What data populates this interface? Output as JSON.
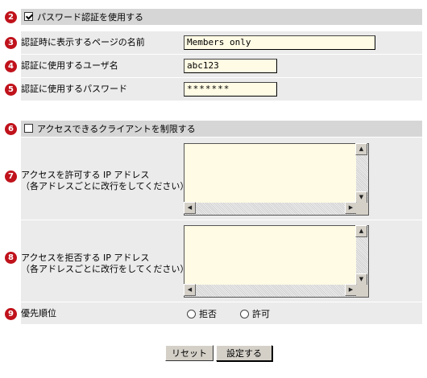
{
  "auth": {
    "use_password_label": "パスワード認証を使用する",
    "use_password_checked": true,
    "page_name_label": "認証時に表示するページの名前",
    "page_name_value": "Members only",
    "username_label": "認証に使用するユーザ名",
    "username_value": "abc123",
    "password_label": "認証に使用するパスワード",
    "password_value": "*******"
  },
  "access": {
    "restrict_label": "アクセスできるクライアントを制限する",
    "restrict_checked": false,
    "allow_label_line1": "アクセスを許可する IP アドレス",
    "allow_label_line2": "（各アドレスごとに改行をしてください）",
    "allow_value": "",
    "deny_label_line1": "アクセスを拒否する IP アドレス",
    "deny_label_line2": "（各アドレスごとに改行をしてください）",
    "deny_value": "",
    "priority_label": "優先順位",
    "priority_options": [
      "拒否",
      "許可"
    ],
    "priority_selected": ""
  },
  "badges": [
    "2",
    "3",
    "4",
    "5",
    "6",
    "7",
    "8",
    "9"
  ],
  "buttons": {
    "reset": "リセット",
    "submit": "設定する"
  },
  "icons": {
    "scroll_up": "scroll-up-arrow-icon",
    "scroll_down": "scroll-down-arrow-icon",
    "scroll_left": "scroll-left-arrow-icon",
    "scroll_right": "scroll-right-arrow-icon"
  },
  "colors": {
    "badge": "#c0121b",
    "header_band": "#d6d6d6",
    "row_band": "#ebebeb",
    "field_bg": "#fffbe4"
  }
}
